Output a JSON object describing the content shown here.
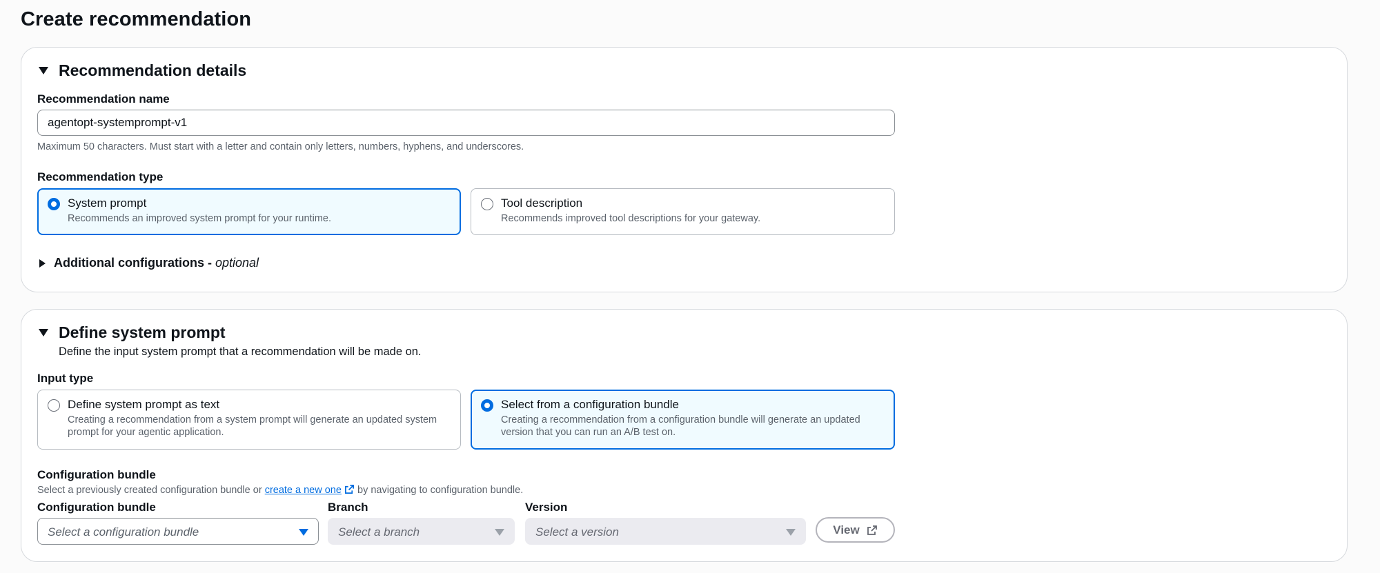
{
  "page": {
    "title": "Create recommendation"
  },
  "details": {
    "title": "Recommendation details",
    "name_label": "Recommendation name",
    "name_value": "agentopt-systemprompt-v1",
    "name_hint": "Maximum 50 characters. Must start with a letter and contain only letters, numbers, hyphens, and underscores.",
    "type_label": "Recommendation type",
    "types": [
      {
        "title": "System prompt",
        "desc": "Recommends an improved system prompt for your runtime.",
        "selected": true
      },
      {
        "title": "Tool description",
        "desc": "Recommends improved tool descriptions for your gateway.",
        "selected": false
      }
    ],
    "additional_label": "Additional configurations -",
    "additional_optional": "optional"
  },
  "define": {
    "title": "Define system prompt",
    "description": "Define the input system prompt that a recommendation will be made on.",
    "input_type_label": "Input type",
    "input_types": [
      {
        "title": "Define system prompt as text",
        "desc1": "Creating a recommendation from a system prompt will generate an updated system",
        "desc2": "prompt for your agentic application.",
        "selected": false
      },
      {
        "title": "Select from a configuration bundle",
        "desc1": "Creating a recommendation from a configuration bundle will generate an updated",
        "desc2": "version that you can run an A/B test on.",
        "selected": true
      }
    ],
    "bundle_heading": "Configuration bundle",
    "bundle_hint_pre": "Select a previously created configuration bundle or",
    "bundle_hint_link": "create a new one",
    "bundle_hint_post": "by navigating to configuration bundle.",
    "fields": {
      "bundle_label": "Configuration bundle",
      "bundle_placeholder": "Select a configuration bundle",
      "branch_label": "Branch",
      "branch_placeholder": "Select a branch",
      "version_label": "Version",
      "version_placeholder": "Select a version"
    },
    "view_button": "View"
  },
  "colors": {
    "accent": "#006ce0",
    "selected_bg": "#f0fbff",
    "disabled_bg": "#ebebf0"
  },
  "icons": [
    "caret-down-icon",
    "caret-right-icon",
    "external-link-icon",
    "radio-icon",
    "dropdown-caret-icon"
  ]
}
